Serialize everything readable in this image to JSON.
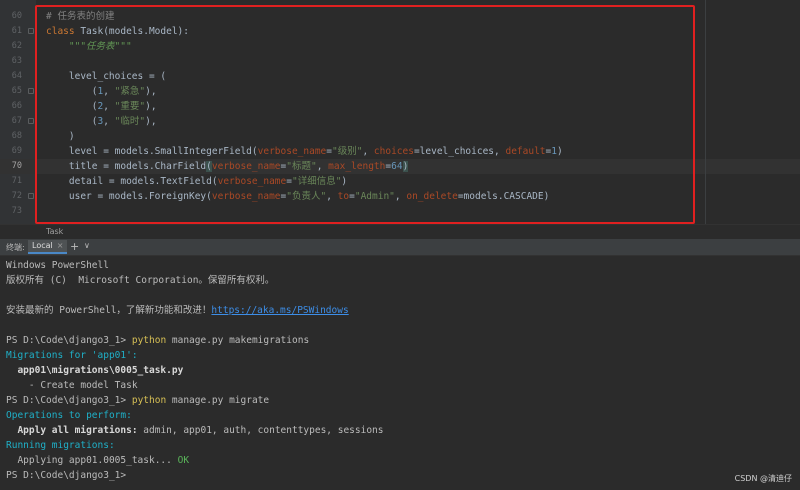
{
  "editor": {
    "lines": [
      {
        "n": "60",
        "parts": [
          {
            "t": "# 任务表的创建",
            "c": "cmt"
          }
        ]
      },
      {
        "n": "61",
        "parts": [
          {
            "t": "class ",
            "c": "kw"
          },
          {
            "t": "Task(models.Model):",
            "c": ""
          }
        ]
      },
      {
        "n": "62",
        "parts": [
          {
            "t": "    ",
            "c": ""
          },
          {
            "t": "\"\"\"任务表\"\"\"",
            "c": "doc"
          }
        ]
      },
      {
        "n": "63",
        "parts": []
      },
      {
        "n": "64",
        "parts": [
          {
            "t": "    level_choices = (",
            "c": ""
          }
        ]
      },
      {
        "n": "65",
        "parts": [
          {
            "t": "        (",
            "c": ""
          },
          {
            "t": "1",
            "c": "num"
          },
          {
            "t": ", ",
            "c": ""
          },
          {
            "t": "\"紧急\"",
            "c": "str"
          },
          {
            "t": "),",
            "c": ""
          }
        ]
      },
      {
        "n": "66",
        "parts": [
          {
            "t": "        (",
            "c": ""
          },
          {
            "t": "2",
            "c": "num"
          },
          {
            "t": ", ",
            "c": ""
          },
          {
            "t": "\"重要\"",
            "c": "str"
          },
          {
            "t": "),",
            "c": ""
          }
        ]
      },
      {
        "n": "67",
        "parts": [
          {
            "t": "        (",
            "c": ""
          },
          {
            "t": "3",
            "c": "num"
          },
          {
            "t": ", ",
            "c": ""
          },
          {
            "t": "\"临时\"",
            "c": "str"
          },
          {
            "t": "),",
            "c": ""
          }
        ]
      },
      {
        "n": "68",
        "parts": [
          {
            "t": "    )",
            "c": ""
          }
        ]
      },
      {
        "n": "69",
        "parts": [
          {
            "t": "    level = models.SmallIntegerField(",
            "c": ""
          },
          {
            "t": "verbose_name",
            "c": "param"
          },
          {
            "t": "=",
            "c": ""
          },
          {
            "t": "\"级别\"",
            "c": "str"
          },
          {
            "t": ", ",
            "c": ""
          },
          {
            "t": "choices",
            "c": "param"
          },
          {
            "t": "=level_choices, ",
            "c": ""
          },
          {
            "t": "default",
            "c": "param"
          },
          {
            "t": "=",
            "c": ""
          },
          {
            "t": "1",
            "c": "num"
          },
          {
            "t": ")",
            "c": ""
          }
        ]
      },
      {
        "n": "70",
        "parts": [
          {
            "t": "    title = models.CharField",
            "c": ""
          },
          {
            "t": "(",
            "c": "hl"
          },
          {
            "t": "verbose_name",
            "c": "param"
          },
          {
            "t": "=",
            "c": ""
          },
          {
            "t": "\"标题\"",
            "c": "str"
          },
          {
            "t": ", ",
            "c": ""
          },
          {
            "t": "max_length",
            "c": "param"
          },
          {
            "t": "=",
            "c": ""
          },
          {
            "t": "64",
            "c": "num"
          },
          {
            "t": ")",
            "c": "hl"
          }
        ]
      },
      {
        "n": "71",
        "parts": [
          {
            "t": "    detail = models.TextField(",
            "c": ""
          },
          {
            "t": "verbose_name",
            "c": "param"
          },
          {
            "t": "=",
            "c": ""
          },
          {
            "t": "\"详细信息\"",
            "c": "str"
          },
          {
            "t": ")",
            "c": ""
          }
        ]
      },
      {
        "n": "72",
        "parts": [
          {
            "t": "    user = models.ForeignKey(",
            "c": ""
          },
          {
            "t": "verbose_name",
            "c": "param"
          },
          {
            "t": "=",
            "c": ""
          },
          {
            "t": "\"负责人\"",
            "c": "str"
          },
          {
            "t": ", ",
            "c": ""
          },
          {
            "t": "to",
            "c": "param"
          },
          {
            "t": "=",
            "c": ""
          },
          {
            "t": "\"Admin\"",
            "c": "str"
          },
          {
            "t": ", ",
            "c": ""
          },
          {
            "t": "on_delete",
            "c": "param"
          },
          {
            "t": "=models.CASCADE)",
            "c": ""
          }
        ]
      },
      {
        "n": "73",
        "parts": []
      }
    ],
    "breadcrumb": "Task"
  },
  "terminal_tabs": {
    "label": "终端:",
    "active_tab": "Local",
    "close_glyph": "×",
    "add_glyph": "+",
    "more_glyph": "∨"
  },
  "terminal": {
    "lines": [
      {
        "parts": [
          {
            "t": "Windows PowerShell",
            "c": ""
          }
        ]
      },
      {
        "parts": [
          {
            "t": "版权所有 (C)  Microsoft Corporation。保留所有权利。",
            "c": ""
          }
        ]
      },
      {
        "parts": []
      },
      {
        "parts": [
          {
            "t": "安装最新的 PowerShell，了解新功能和改进！",
            "c": ""
          },
          {
            "t": "https://aka.ms/PSWindows",
            "c": "link"
          }
        ]
      },
      {
        "parts": []
      },
      {
        "parts": [
          {
            "t": "PS D:\\Code\\django3_1> ",
            "c": ""
          },
          {
            "t": "python",
            "c": "cmd"
          },
          {
            "t": " manage.py makemigrations",
            "c": ""
          }
        ]
      },
      {
        "parts": [
          {
            "t": "Migrations for 'app01':",
            "c": "cyan"
          }
        ]
      },
      {
        "parts": [
          {
            "t": "  app01\\migrations\\0005_task.py",
            "c": "bold"
          }
        ]
      },
      {
        "parts": [
          {
            "t": "    - Create model Task",
            "c": ""
          }
        ]
      },
      {
        "parts": [
          {
            "t": "PS D:\\Code\\django3_1> ",
            "c": ""
          },
          {
            "t": "python",
            "c": "cmd"
          },
          {
            "t": " manage.py migrate",
            "c": ""
          }
        ]
      },
      {
        "parts": [
          {
            "t": "Operations to perform:",
            "c": "cyan"
          }
        ]
      },
      {
        "parts": [
          {
            "t": "  Apply all migrations:",
            "c": "bold"
          },
          {
            "t": " admin, app01, auth, contenttypes, sessions",
            "c": ""
          }
        ]
      },
      {
        "parts": [
          {
            "t": "Running migrations:",
            "c": "cyan"
          }
        ]
      },
      {
        "parts": [
          {
            "t": "  Applying app01.0005_task...",
            "c": ""
          },
          {
            "t": " OK",
            "c": "green"
          }
        ]
      },
      {
        "parts": [
          {
            "t": "PS D:\\Code\\django3_1>",
            "c": ""
          }
        ]
      }
    ]
  },
  "watermark": "CSDN @清迪仔"
}
